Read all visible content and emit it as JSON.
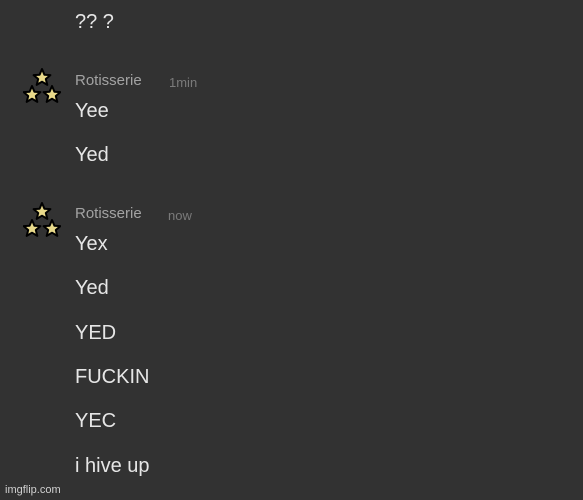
{
  "chat": {
    "previous_message": "?? ?",
    "groups": [
      {
        "author": "Rotisserie",
        "time": "1min",
        "avatar_icon": "three-stars-icon",
        "messages": [
          "Yee",
          "Yed"
        ]
      },
      {
        "author": "Rotisserie",
        "time": "now",
        "avatar_icon": "three-stars-icon",
        "messages": [
          "Yex",
          "Yed",
          "YED",
          "FUCKIN",
          "YEC",
          "i hive up"
        ]
      }
    ]
  },
  "watermark": "imgflip.com",
  "colors": {
    "background": "#323232",
    "message_text": "#e6e6e6",
    "author_text": "#a3a3a3",
    "timestamp_text": "#7a7a7a",
    "star_fill": "#e8d98a",
    "star_outline": "#000000"
  }
}
